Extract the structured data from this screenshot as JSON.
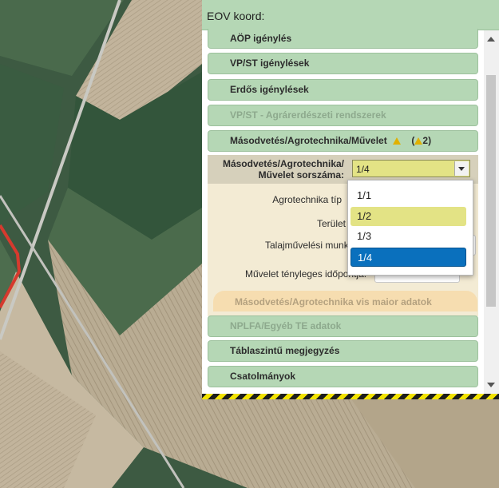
{
  "header": {
    "eov_label": "EOV koord:"
  },
  "sections": {
    "aop": "AÖP igénylés",
    "vpst": "VP/ST igénylések",
    "erdos": "Erdős igénylések",
    "vpst_agrar": "VP/ST - Agrárerdészeti rendszerek",
    "masodvetes": "Másodvetés/Agrotechnika/Művelet",
    "warning_count": "2",
    "nplfa": "NPLFA/Egyéb TE adatok",
    "tablaszintu": "Táblaszintű megjegyzés",
    "csatolmanyok": "Csatolmányok"
  },
  "form": {
    "sorszam_label_line1": "Másodvetés/Agrotechnika/",
    "sorszam_label_line2": "Művelet sorszáma:",
    "sorszam_value": "1/4",
    "agrotechnika_tipus_label": "Agrotechnika típ",
    "terulet_label": "Terület",
    "talajmuvelesi_label": "Talajművelési munk",
    "idopont_label": "Művelet tényleges időpontja:",
    "vis_maior_header": "Másodvetés/Agrotechnika vis maior adatok"
  },
  "dropdown": {
    "options": [
      "1/1",
      "1/2",
      "1/3",
      "1/4"
    ],
    "hovered": "1/2",
    "selected": "1/4"
  },
  "colors": {
    "header_green": "#b5d7b5",
    "selected_blue": "#0a70bd",
    "highlight_yellow": "#e3e385",
    "section_beige": "#f3ebd4"
  }
}
